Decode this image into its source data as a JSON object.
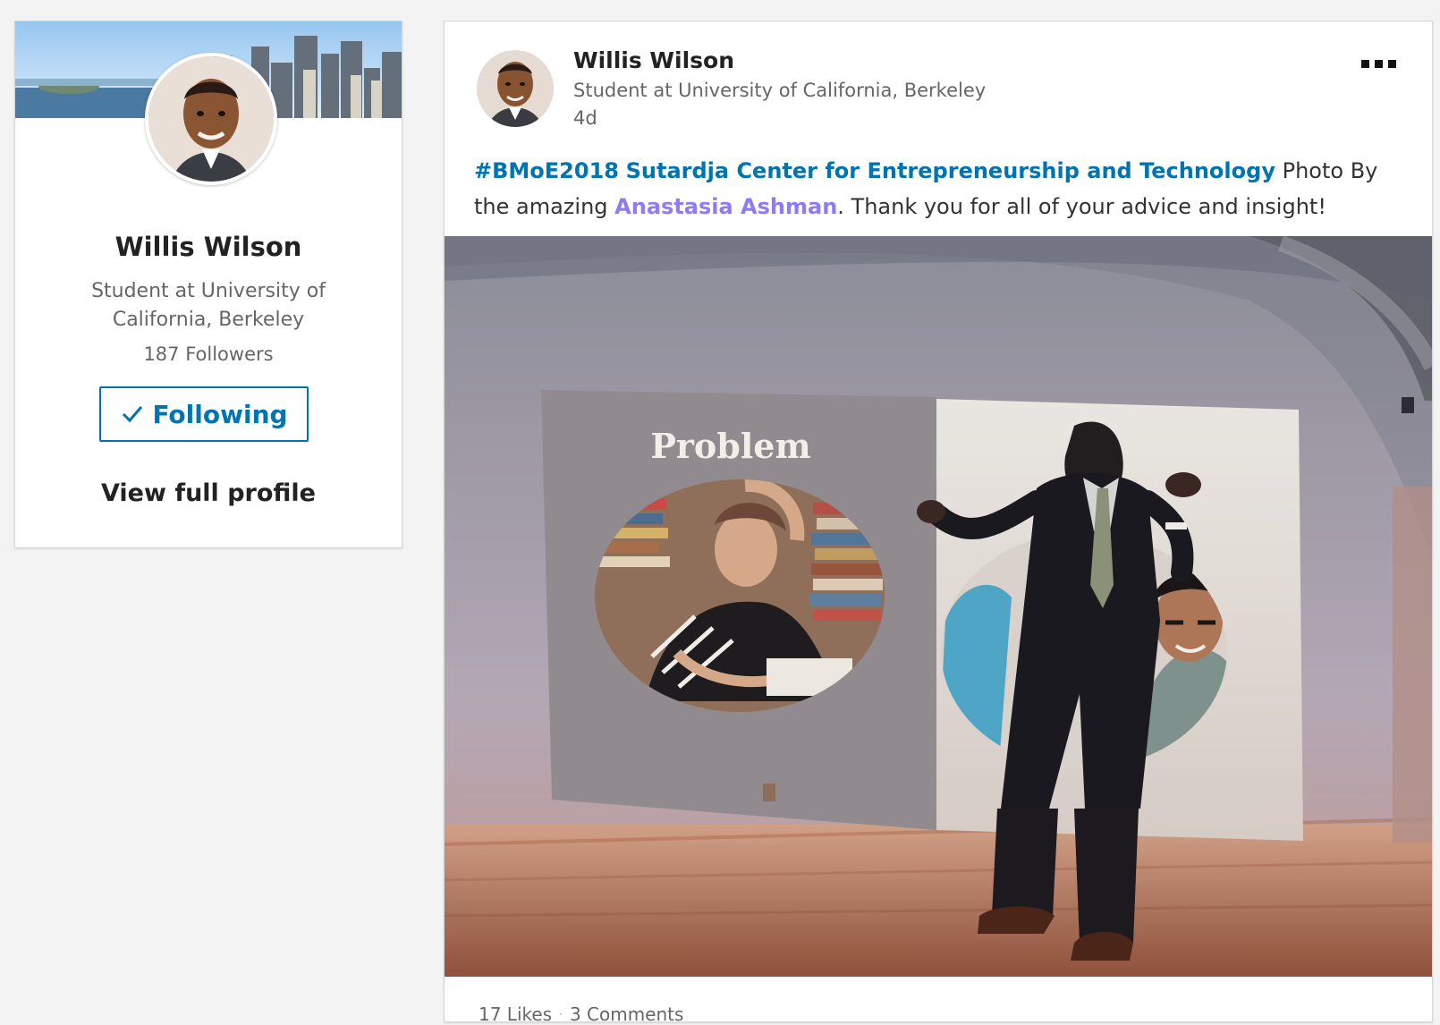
{
  "profile_card": {
    "name": "Willis Wilson",
    "headline": "Student at University of California, Berkeley",
    "followers": "187 Followers",
    "following_label": "Following",
    "view_profile_label": "View full profile",
    "check_icon": "check-icon"
  },
  "post": {
    "author": "Willis Wilson",
    "headline": "Student at University of California, Berkeley",
    "age": "4d",
    "more_icon": "more-options-icon",
    "text": {
      "hashtag": "#BMoE2018",
      "org_link": "Sutardja Center for Entrepreneurship and Technology",
      "mid_text": "Photo By the amazing",
      "person_link": "Anastasia Ashman",
      "end_text": ". Thank you for all of your advice and insight!"
    },
    "slide_text": "Problem",
    "stats": {
      "likes": "17 Likes",
      "separator": "·",
      "comments": "3 Comments"
    }
  },
  "colors": {
    "link_blue": "#0073b1",
    "mention_purple": "#8f7cf5",
    "page_background": "#f3f3f3"
  }
}
